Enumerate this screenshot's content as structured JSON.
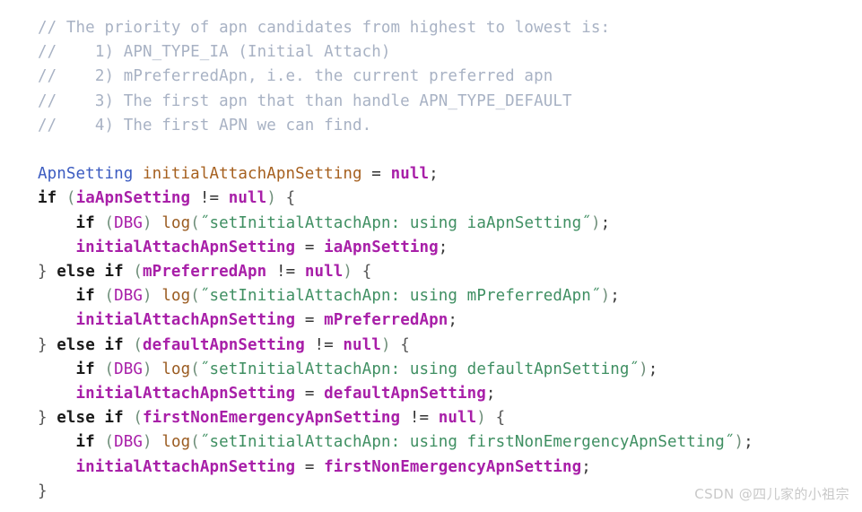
{
  "meta": {
    "language": "java",
    "background_color": "#ffffff",
    "default_text_color": "#303030"
  },
  "palette": {
    "comment": "#a8b2c4",
    "type": "#3b5bc0",
    "declaration": "#a6601f",
    "identifier": "#a81fa8",
    "keyword": "#1a1a1a",
    "constant": "#a81fa8",
    "function": "#9a5b20",
    "string": "#3f8f62",
    "punctuation": "#3a3a3a",
    "watermark": "#c9c9c9"
  },
  "code": {
    "lines": [
      {
        "number": 1,
        "text": "// The priority of apn candidates from highest to lowest is:",
        "tokens": [
          {
            "t": "// The priority of apn candidates from highest to lowest is:",
            "c": "tok-comment"
          }
        ]
      },
      {
        "number": 2,
        "text": "//   1) APN_TYPE_IA (Initial Attach)",
        "tokens": [
          {
            "t": "//    1) APN_TYPE_IA (Initial Attach)",
            "c": "tok-comment"
          }
        ]
      },
      {
        "number": 3,
        "text": "//   2) mPreferredApn, i.e. the current preferred apn",
        "tokens": [
          {
            "t": "//    2) mPreferredApn, i.e. the current preferred apn",
            "c": "tok-comment"
          }
        ]
      },
      {
        "number": 4,
        "text": "//   3) The first apn that than handle APN_TYPE_DEFAULT",
        "tokens": [
          {
            "t": "//    3) The first apn that than handle APN_TYPE_DEFAULT",
            "c": "tok-comment"
          }
        ]
      },
      {
        "number": 5,
        "text": "//   4) The first APN we can find.",
        "tokens": [
          {
            "t": "//    4) The first APN we can find.",
            "c": "tok-comment"
          }
        ]
      },
      {
        "number": 6,
        "text": "",
        "tokens": []
      },
      {
        "number": 7,
        "text": "ApnSetting initialAttachApnSetting = null;",
        "tokens": [
          {
            "t": "ApnSetting",
            "c": "tok-type"
          },
          {
            "t": " ",
            "c": "tok-plain"
          },
          {
            "t": "initialAttachApnSetting",
            "c": "tok-decl"
          },
          {
            "t": " ",
            "c": "tok-plain"
          },
          {
            "t": "=",
            "c": "tok-op"
          },
          {
            "t": " ",
            "c": "tok-plain"
          },
          {
            "t": "null",
            "c": "tok-const"
          },
          {
            "t": ";",
            "c": "tok-punct"
          }
        ]
      },
      {
        "number": 8,
        "text": "if (iaApnSetting != null) {",
        "tokens": [
          {
            "t": "if",
            "c": "tok-keyword"
          },
          {
            "t": " ",
            "c": "tok-plain"
          },
          {
            "t": "(",
            "c": "tok-paren"
          },
          {
            "t": "iaApnSetting",
            "c": "tok-ident"
          },
          {
            "t": " ",
            "c": "tok-plain"
          },
          {
            "t": "!=",
            "c": "tok-op"
          },
          {
            "t": " ",
            "c": "tok-plain"
          },
          {
            "t": "null",
            "c": "tok-const"
          },
          {
            "t": ")",
            "c": "tok-paren"
          },
          {
            "t": " ",
            "c": "tok-plain"
          },
          {
            "t": "{",
            "c": "tok-brace"
          }
        ]
      },
      {
        "number": 9,
        "text": "    if (DBG) log(\"setInitialAttachApn: using iaApnSetting\");",
        "tokens": [
          {
            "t": "    ",
            "c": "tok-plain"
          },
          {
            "t": "if",
            "c": "tok-keyword"
          },
          {
            "t": " ",
            "c": "tok-plain"
          },
          {
            "t": "(",
            "c": "tok-paren"
          },
          {
            "t": "DBG",
            "c": "tok-const-lt"
          },
          {
            "t": ")",
            "c": "tok-paren"
          },
          {
            "t": " ",
            "c": "tok-plain"
          },
          {
            "t": "log",
            "c": "tok-func"
          },
          {
            "t": "(",
            "c": "tok-paren"
          },
          {
            "t": "˝setInitialAttachApn: using iaApnSetting˝",
            "c": "tok-string"
          },
          {
            "t": ")",
            "c": "tok-paren"
          },
          {
            "t": ";",
            "c": "tok-punct"
          }
        ]
      },
      {
        "number": 10,
        "text": "    initialAttachApnSetting = iaApnSetting;",
        "tokens": [
          {
            "t": "    ",
            "c": "tok-plain"
          },
          {
            "t": "initialAttachApnSetting",
            "c": "tok-ident"
          },
          {
            "t": " ",
            "c": "tok-plain"
          },
          {
            "t": "=",
            "c": "tok-op"
          },
          {
            "t": " ",
            "c": "tok-plain"
          },
          {
            "t": "iaApnSetting",
            "c": "tok-ident"
          },
          {
            "t": ";",
            "c": "tok-punct"
          }
        ]
      },
      {
        "number": 11,
        "text": "} else if (mPreferredApn != null) {",
        "tokens": [
          {
            "t": "}",
            "c": "tok-brace"
          },
          {
            "t": " ",
            "c": "tok-plain"
          },
          {
            "t": "else if",
            "c": "tok-keyword"
          },
          {
            "t": " ",
            "c": "tok-plain"
          },
          {
            "t": "(",
            "c": "tok-paren"
          },
          {
            "t": "mPreferredApn",
            "c": "tok-ident"
          },
          {
            "t": " ",
            "c": "tok-plain"
          },
          {
            "t": "!=",
            "c": "tok-op"
          },
          {
            "t": " ",
            "c": "tok-plain"
          },
          {
            "t": "null",
            "c": "tok-const"
          },
          {
            "t": ")",
            "c": "tok-paren"
          },
          {
            "t": " ",
            "c": "tok-plain"
          },
          {
            "t": "{",
            "c": "tok-brace"
          }
        ]
      },
      {
        "number": 12,
        "text": "    if (DBG) log(\"setInitialAttachApn: using mPreferredApn\");",
        "tokens": [
          {
            "t": "    ",
            "c": "tok-plain"
          },
          {
            "t": "if",
            "c": "tok-keyword"
          },
          {
            "t": " ",
            "c": "tok-plain"
          },
          {
            "t": "(",
            "c": "tok-paren"
          },
          {
            "t": "DBG",
            "c": "tok-const-lt"
          },
          {
            "t": ")",
            "c": "tok-paren"
          },
          {
            "t": " ",
            "c": "tok-plain"
          },
          {
            "t": "log",
            "c": "tok-func"
          },
          {
            "t": "(",
            "c": "tok-paren"
          },
          {
            "t": "˝setInitialAttachApn: using mPreferredApn˝",
            "c": "tok-string"
          },
          {
            "t": ")",
            "c": "tok-paren"
          },
          {
            "t": ";",
            "c": "tok-punct"
          }
        ]
      },
      {
        "number": 13,
        "text": "    initialAttachApnSetting = mPreferredApn;",
        "tokens": [
          {
            "t": "    ",
            "c": "tok-plain"
          },
          {
            "t": "initialAttachApnSetting",
            "c": "tok-ident"
          },
          {
            "t": " ",
            "c": "tok-plain"
          },
          {
            "t": "=",
            "c": "tok-op"
          },
          {
            "t": " ",
            "c": "tok-plain"
          },
          {
            "t": "mPreferredApn",
            "c": "tok-ident"
          },
          {
            "t": ";",
            "c": "tok-punct"
          }
        ]
      },
      {
        "number": 14,
        "text": "} else if (defaultApnSetting != null) {",
        "tokens": [
          {
            "t": "}",
            "c": "tok-brace"
          },
          {
            "t": " ",
            "c": "tok-plain"
          },
          {
            "t": "else if",
            "c": "tok-keyword"
          },
          {
            "t": " ",
            "c": "tok-plain"
          },
          {
            "t": "(",
            "c": "tok-paren"
          },
          {
            "t": "defaultApnSetting",
            "c": "tok-ident"
          },
          {
            "t": " ",
            "c": "tok-plain"
          },
          {
            "t": "!=",
            "c": "tok-op"
          },
          {
            "t": " ",
            "c": "tok-plain"
          },
          {
            "t": "null",
            "c": "tok-const"
          },
          {
            "t": ")",
            "c": "tok-paren"
          },
          {
            "t": " ",
            "c": "tok-plain"
          },
          {
            "t": "{",
            "c": "tok-brace"
          }
        ]
      },
      {
        "number": 15,
        "text": "    if (DBG) log(\"setInitialAttachApn: using defaultApnSetting\");",
        "tokens": [
          {
            "t": "    ",
            "c": "tok-plain"
          },
          {
            "t": "if",
            "c": "tok-keyword"
          },
          {
            "t": " ",
            "c": "tok-plain"
          },
          {
            "t": "(",
            "c": "tok-paren"
          },
          {
            "t": "DBG",
            "c": "tok-const-lt"
          },
          {
            "t": ")",
            "c": "tok-paren"
          },
          {
            "t": " ",
            "c": "tok-plain"
          },
          {
            "t": "log",
            "c": "tok-func"
          },
          {
            "t": "(",
            "c": "tok-paren"
          },
          {
            "t": "˝setInitialAttachApn: using defaultApnSetting˝",
            "c": "tok-string"
          },
          {
            "t": ")",
            "c": "tok-paren"
          },
          {
            "t": ";",
            "c": "tok-punct"
          }
        ]
      },
      {
        "number": 16,
        "text": "    initialAttachApnSetting = defaultApnSetting;",
        "tokens": [
          {
            "t": "    ",
            "c": "tok-plain"
          },
          {
            "t": "initialAttachApnSetting",
            "c": "tok-ident"
          },
          {
            "t": " ",
            "c": "tok-plain"
          },
          {
            "t": "=",
            "c": "tok-op"
          },
          {
            "t": " ",
            "c": "tok-plain"
          },
          {
            "t": "defaultApnSetting",
            "c": "tok-ident"
          },
          {
            "t": ";",
            "c": "tok-punct"
          }
        ]
      },
      {
        "number": 17,
        "text": "} else if (firstNonEmergencyApnSetting != null) {",
        "tokens": [
          {
            "t": "}",
            "c": "tok-brace"
          },
          {
            "t": " ",
            "c": "tok-plain"
          },
          {
            "t": "else if",
            "c": "tok-keyword"
          },
          {
            "t": " ",
            "c": "tok-plain"
          },
          {
            "t": "(",
            "c": "tok-paren"
          },
          {
            "t": "firstNonEmergencyApnSetting",
            "c": "tok-ident"
          },
          {
            "t": " ",
            "c": "tok-plain"
          },
          {
            "t": "!=",
            "c": "tok-op"
          },
          {
            "t": " ",
            "c": "tok-plain"
          },
          {
            "t": "null",
            "c": "tok-const"
          },
          {
            "t": ")",
            "c": "tok-paren"
          },
          {
            "t": " ",
            "c": "tok-plain"
          },
          {
            "t": "{",
            "c": "tok-brace"
          }
        ]
      },
      {
        "number": 18,
        "text": "    if (DBG) log(\"setInitialAttachApn: using firstNonEmergencyApnSetting\");",
        "tokens": [
          {
            "t": "    ",
            "c": "tok-plain"
          },
          {
            "t": "if",
            "c": "tok-keyword"
          },
          {
            "t": " ",
            "c": "tok-plain"
          },
          {
            "t": "(",
            "c": "tok-paren"
          },
          {
            "t": "DBG",
            "c": "tok-const-lt"
          },
          {
            "t": ")",
            "c": "tok-paren"
          },
          {
            "t": " ",
            "c": "tok-plain"
          },
          {
            "t": "log",
            "c": "tok-func"
          },
          {
            "t": "(",
            "c": "tok-paren"
          },
          {
            "t": "˝setInitialAttachApn: using firstNonEmergencyApnSetting˝",
            "c": "tok-string"
          },
          {
            "t": ")",
            "c": "tok-paren"
          },
          {
            "t": ";",
            "c": "tok-punct"
          }
        ]
      },
      {
        "number": 19,
        "text": "    initialAttachApnSetting = firstNonEmergencyApnSetting;",
        "tokens": [
          {
            "t": "    ",
            "c": "tok-plain"
          },
          {
            "t": "initialAttachApnSetting",
            "c": "tok-ident"
          },
          {
            "t": " ",
            "c": "tok-plain"
          },
          {
            "t": "=",
            "c": "tok-op"
          },
          {
            "t": " ",
            "c": "tok-plain"
          },
          {
            "t": "firstNonEmergencyApnSetting",
            "c": "tok-ident"
          },
          {
            "t": ";",
            "c": "tok-punct"
          }
        ]
      },
      {
        "number": 20,
        "text": "}",
        "tokens": [
          {
            "t": "}",
            "c": "tok-brace"
          }
        ]
      }
    ]
  },
  "watermark": {
    "text": "CSDN @四儿家的小祖宗"
  }
}
